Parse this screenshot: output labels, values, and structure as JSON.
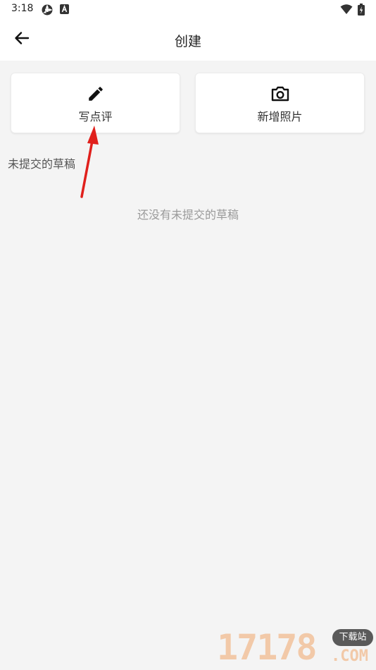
{
  "status_bar": {
    "time": "3:18"
  },
  "app_bar": {
    "title": "创建"
  },
  "actions": [
    {
      "label": "写点评",
      "icon": "pencil-icon"
    },
    {
      "label": "新增照片",
      "icon": "camera-icon"
    }
  ],
  "drafts": {
    "section_title": "未提交的草稿",
    "empty_message": "还没有未提交的草稿"
  },
  "watermark": {
    "number": "17178",
    "badge": "下载站",
    "suffix": ".COM"
  },
  "colors": {
    "annotation_arrow": "#e0201c",
    "background": "#f4f4f4"
  }
}
